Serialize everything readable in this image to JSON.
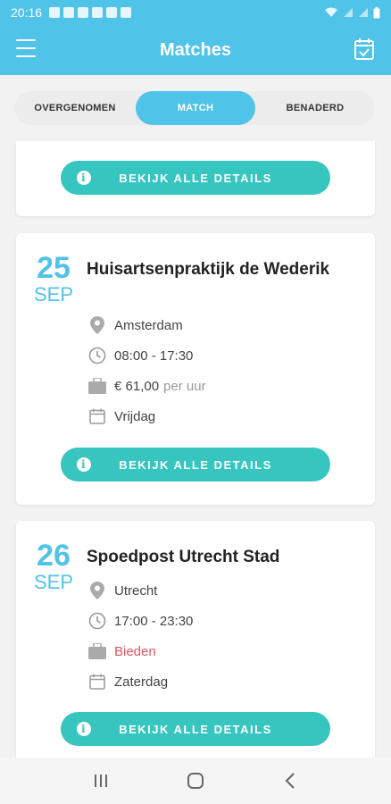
{
  "status": {
    "time": "20:16"
  },
  "header": {
    "title": "Matches",
    "accent": "#4fc3e8"
  },
  "tabs": [
    {
      "label": "OVERGENOMEN"
    },
    {
      "label": "MATCH",
      "active": true
    },
    {
      "label": "BENADERD"
    }
  ],
  "details_button_label": "BEKIJK ALLE DETAILS",
  "matches": [
    {
      "day": "25",
      "month": "SEP",
      "title": "Huisartsenpraktijk de Wederik",
      "location": "Amsterdam",
      "time": "08:00 - 17:30",
      "rate": "€ 61,00",
      "rate_unit": "per uur",
      "weekday": "Vrijdag"
    },
    {
      "day": "26",
      "month": "SEP",
      "title": "Spoedpost Utrecht Stad",
      "location": "Utrecht",
      "time": "17:00 - 23:30",
      "rate": "Bieden",
      "weekday": "Zaterdag"
    }
  ],
  "colors": {
    "accent": "#4fc3e8",
    "button": "#37c5c0",
    "bid": "#e05563"
  }
}
